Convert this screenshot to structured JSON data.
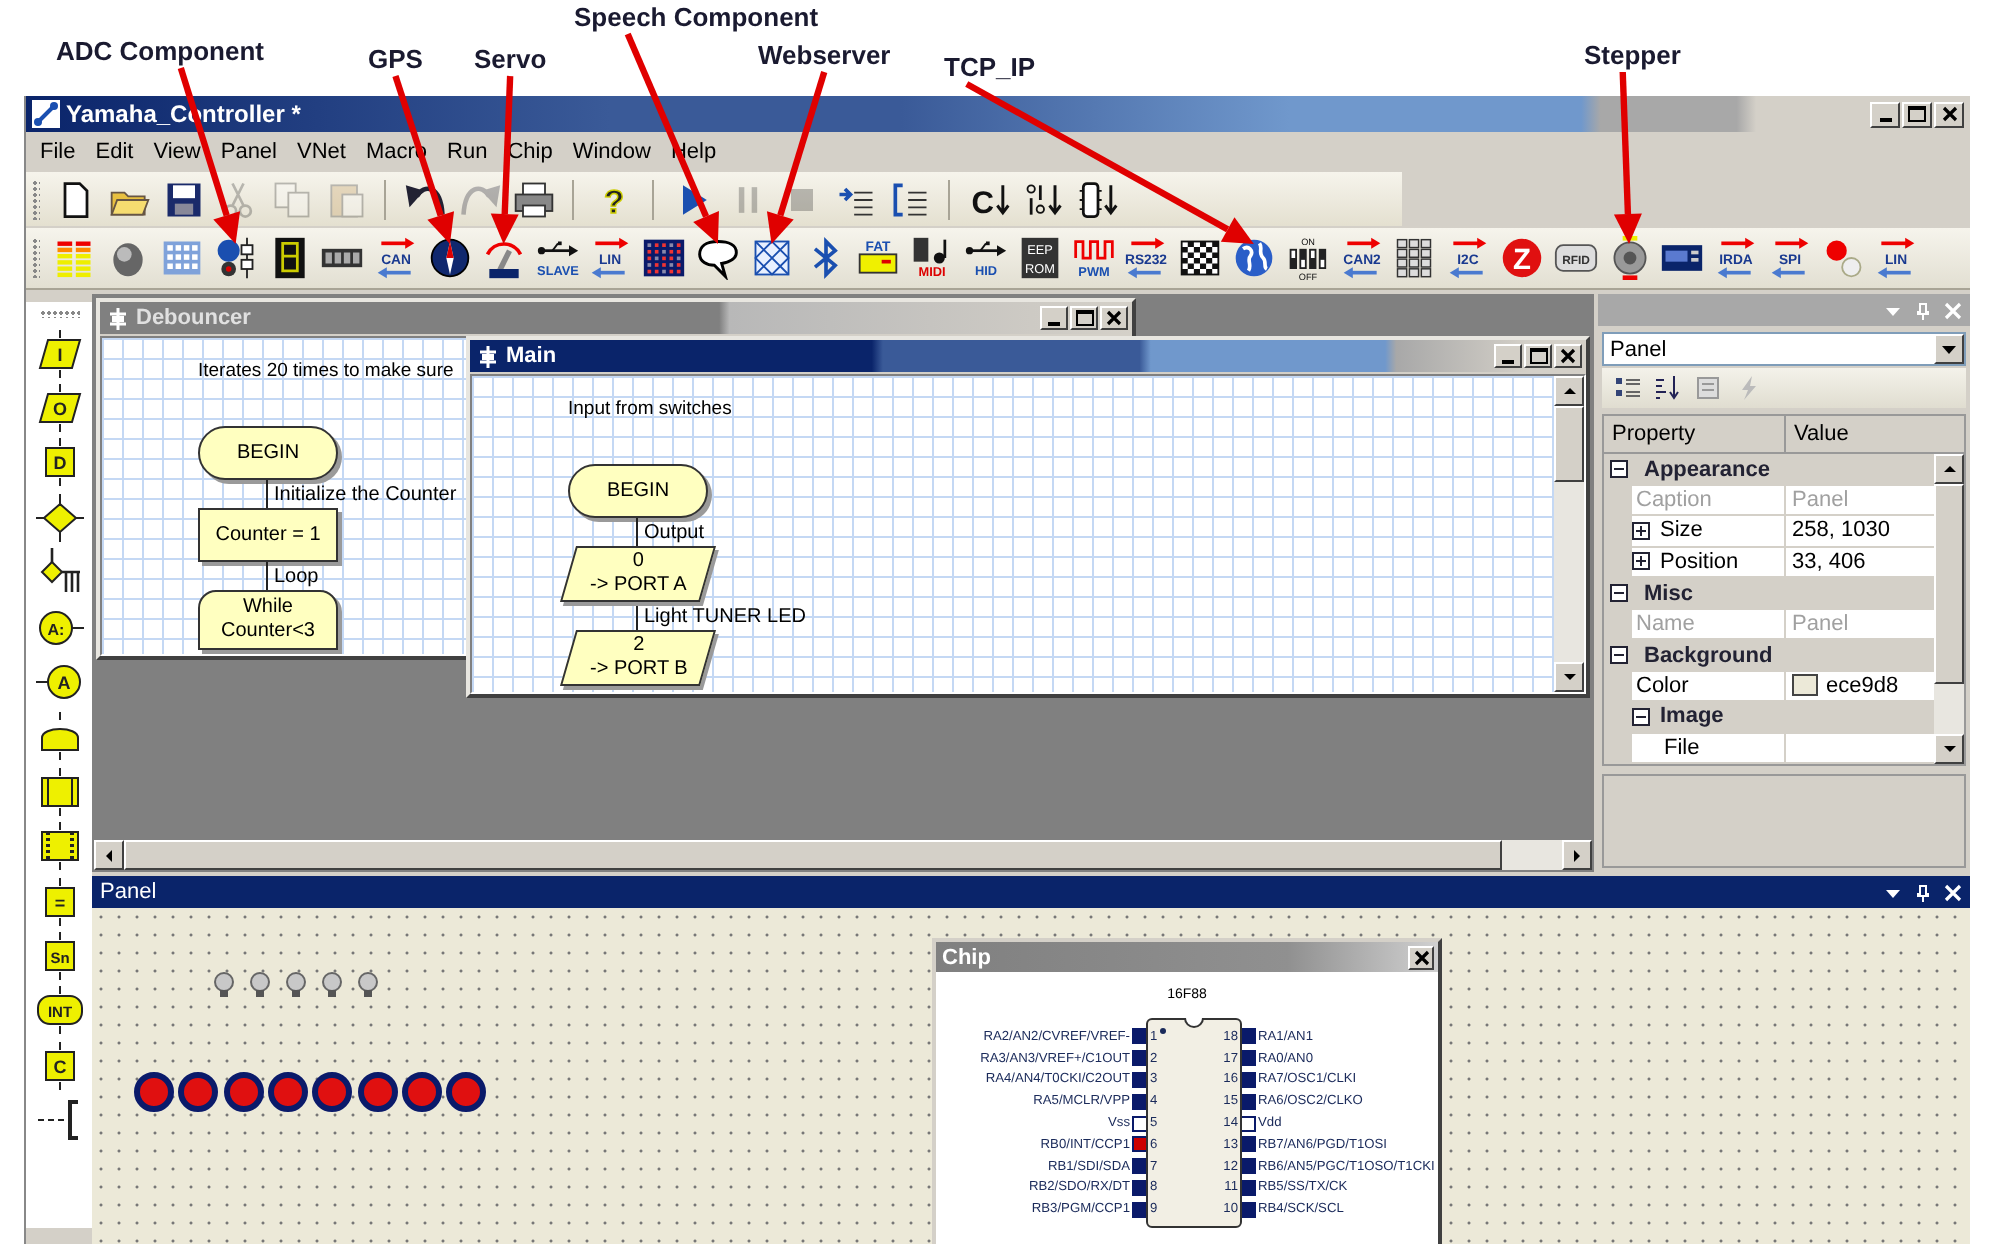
{
  "annotations": [
    {
      "text": "ADC Component"
    },
    {
      "text": "GPS"
    },
    {
      "text": "Servo"
    },
    {
      "text": "Speech Component"
    },
    {
      "text": "Webserver"
    },
    {
      "text": "TCP_IP"
    },
    {
      "text": "Stepper"
    }
  ],
  "window": {
    "title": "Yamaha_Controller *"
  },
  "menu": [
    "File",
    "Edit",
    "View",
    "Panel",
    "VNet",
    "Macro",
    "Run",
    "Chip",
    "Window",
    "Help"
  ],
  "main_toolbar": {
    "groups": [
      [
        {
          "kind": "new",
          "disabled": false
        },
        {
          "kind": "open",
          "disabled": false
        },
        {
          "kind": "save",
          "disabled": false
        },
        {
          "kind": "cut",
          "disabled": true
        },
        {
          "kind": "copy",
          "disabled": true
        },
        {
          "kind": "paste",
          "disabled": true
        }
      ],
      [
        {
          "kind": "undo",
          "disabled": false
        },
        {
          "kind": "redo",
          "disabled": true
        },
        {
          "kind": "print",
          "disabled": false
        }
      ],
      [
        {
          "kind": "help",
          "label": "?",
          "disabled": false
        }
      ],
      [
        {
          "kind": "run",
          "disabled": false
        },
        {
          "kind": "pause",
          "disabled": true
        },
        {
          "kind": "stop",
          "disabled": true
        },
        {
          "kind": "step-into",
          "disabled": false
        },
        {
          "kind": "step-over",
          "disabled": false
        }
      ],
      [
        {
          "kind": "compile-c",
          "label": "C",
          "disabled": false
        },
        {
          "kind": "compile-hex",
          "disabled": false
        },
        {
          "kind": "compile-chip",
          "disabled": false
        }
      ]
    ]
  },
  "component_toolbar": [
    {
      "kind": "meter"
    },
    {
      "kind": "knob"
    },
    {
      "kind": "keypad"
    },
    {
      "kind": "adc"
    },
    {
      "kind": "seg7"
    },
    {
      "kind": "lcdnum"
    },
    {
      "kind": "bus",
      "label": "CAN"
    },
    {
      "kind": "compass"
    },
    {
      "kind": "gauge"
    },
    {
      "kind": "usb",
      "label": "SLAVE"
    },
    {
      "kind": "bus",
      "label": "LIN"
    },
    {
      "kind": "matrix"
    },
    {
      "kind": "bubble"
    },
    {
      "kind": "web"
    },
    {
      "kind": "bluetooth"
    },
    {
      "kind": "card",
      "label": "FAT"
    },
    {
      "kind": "midi",
      "label": "MIDI"
    },
    {
      "kind": "usb",
      "label": "HID"
    },
    {
      "kind": "chiplabel",
      "lines": [
        "EEP",
        "ROM"
      ]
    },
    {
      "kind": "pwm",
      "label": "PWM"
    },
    {
      "kind": "bus",
      "label": "RS232"
    },
    {
      "kind": "flag"
    },
    {
      "kind": "globe"
    },
    {
      "kind": "dip",
      "lines": [
        "ON",
        "OFF"
      ]
    },
    {
      "kind": "bus",
      "label": "CAN2"
    },
    {
      "kind": "keys"
    },
    {
      "kind": "bus",
      "label": "I2C"
    },
    {
      "kind": "zigbee",
      "label": "Z"
    },
    {
      "kind": "rfid",
      "label": "RFID"
    },
    {
      "kind": "motor"
    },
    {
      "kind": "lcd"
    },
    {
      "kind": "bus",
      "label": "IRDA"
    },
    {
      "kind": "bus",
      "label": "SPI"
    },
    {
      "kind": "led"
    },
    {
      "kind": "bus",
      "label": "LIN"
    }
  ],
  "flowchart_tools": [
    {
      "kind": "input",
      "label": "I"
    },
    {
      "kind": "output",
      "label": "O"
    },
    {
      "kind": "delay",
      "label": "D"
    },
    {
      "kind": "decision"
    },
    {
      "kind": "switch"
    },
    {
      "kind": "macro",
      "label": "A:"
    },
    {
      "kind": "component",
      "label": "A"
    },
    {
      "kind": "loop"
    },
    {
      "kind": "calculation"
    },
    {
      "kind": "code-macro"
    },
    {
      "kind": "box",
      "label": "="
    },
    {
      "kind": "box",
      "label": "Sn"
    },
    {
      "kind": "interrupt",
      "label": "INT"
    },
    {
      "kind": "box",
      "label": "C"
    },
    {
      "kind": "comment"
    }
  ],
  "windows": [
    {
      "title": "Debouncer",
      "active": false,
      "comment": "Iterates 20 times to make sure",
      "flow": [
        {
          "kind": "terminator",
          "lines": [
            "BEGIN"
          ]
        },
        {
          "kind": "process",
          "note": "Initialize the Counter",
          "lines": [
            "Counter = 1"
          ]
        },
        {
          "kind": "loop",
          "note": "Loop",
          "lines": [
            "While",
            "Counter<3"
          ]
        }
      ]
    },
    {
      "title": "Main",
      "active": true,
      "comment": "Input from switches",
      "flow": [
        {
          "kind": "terminator",
          "lines": [
            "BEGIN"
          ]
        },
        {
          "kind": "io",
          "note": "Output",
          "lines": [
            "0",
            "-> PORT A"
          ]
        },
        {
          "kind": "io",
          "note": "Light TUNER LED",
          "lines": [
            "2",
            "-> PORT B"
          ]
        }
      ]
    }
  ],
  "properties": {
    "selector": "Panel",
    "columns": [
      "Property",
      "Value"
    ],
    "categories": [
      {
        "label": "Appearance",
        "expanded": true,
        "children": [
          {
            "name": "Caption",
            "value": "Panel",
            "disabled": true
          },
          {
            "name": "Size",
            "value": "258, 1030",
            "disabled": false,
            "expanded": false
          },
          {
            "name": "Position",
            "value": "33, 406",
            "disabled": false,
            "expanded": false
          }
        ]
      },
      {
        "label": "Misc",
        "expanded": true,
        "children": [
          {
            "name": "Name",
            "value": "Panel",
            "disabled": true
          }
        ]
      },
      {
        "label": "Background",
        "expanded": true,
        "children": [
          {
            "name": "Color",
            "value": "ece9d8",
            "color": "#ece9d8",
            "disabled": false
          },
          {
            "name": "Image",
            "expanded": true,
            "children": [
              {
                "name": "File",
                "disabled": false
              }
            ]
          }
        ]
      }
    ]
  },
  "panel": {
    "title": "Panel",
    "bulbs": [
      {
        "lit": false
      },
      {
        "lit": false
      },
      {
        "lit": false
      },
      {
        "lit": false
      },
      {
        "lit": false
      }
    ],
    "leds": [
      {
        "lit": true
      },
      {
        "lit": true
      },
      {
        "lit": true
      },
      {
        "lit": true
      },
      {
        "lit": true
      },
      {
        "lit": true
      },
      {
        "lit": true
      },
      {
        "lit": true
      }
    ],
    "chip": {
      "title": "Chip",
      "part": "16F88",
      "pins": [
        {
          "number": "1",
          "label": "RA2/AN2/CVREF/VREF-",
          "color": "#0a1a6a"
        },
        {
          "number": "18",
          "label": "RA1/AN1",
          "color": "#0a1a6a"
        },
        {
          "number": "2",
          "label": "RA3/AN3/VREF+/C1OUT",
          "color": "#0a1a6a"
        },
        {
          "number": "17",
          "label": "RA0/AN0",
          "color": "#0a1a6a"
        },
        {
          "number": "3",
          "label": "RA4/AN4/T0CKI/C2OUT",
          "color": "#0a1a6a"
        },
        {
          "number": "16",
          "label": "RA7/OSC1/CLKI",
          "color": "#0a1a6a"
        },
        {
          "number": "4",
          "label": "RA5/MCLR/VPP",
          "color": "#0a1a6a"
        },
        {
          "number": "15",
          "label": "RA6/OSC2/CLKO",
          "color": "#0a1a6a"
        },
        {
          "number": "5",
          "label": "Vss",
          "color": "#ffffff"
        },
        {
          "number": "14",
          "label": "Vdd",
          "color": "#ffffff"
        },
        {
          "number": "6",
          "label": "RB0/INT/CCP1",
          "color": "#cc0000"
        },
        {
          "number": "13",
          "label": "RB7/AN6/PGD/T1OSI",
          "color": "#0a1a6a"
        },
        {
          "number": "7",
          "label": "RB1/SDI/SDA",
          "color": "#0a1a6a"
        },
        {
          "number": "12",
          "label": "RB6/AN5/PGC/T1OSO/T1CKI",
          "color": "#0a1a6a"
        },
        {
          "number": "8",
          "label": "RB2/SDO/RX/DT",
          "color": "#0a1a6a"
        },
        {
          "number": "11",
          "label": "RB5/SS/TX/CK",
          "color": "#0a1a6a"
        },
        {
          "number": "9",
          "label": "RB3/PGM/CCP1",
          "color": "#0a1a6a"
        },
        {
          "number": "10",
          "label": "RB4/SCK/SCL",
          "color": "#0a1a6a"
        }
      ]
    }
  }
}
